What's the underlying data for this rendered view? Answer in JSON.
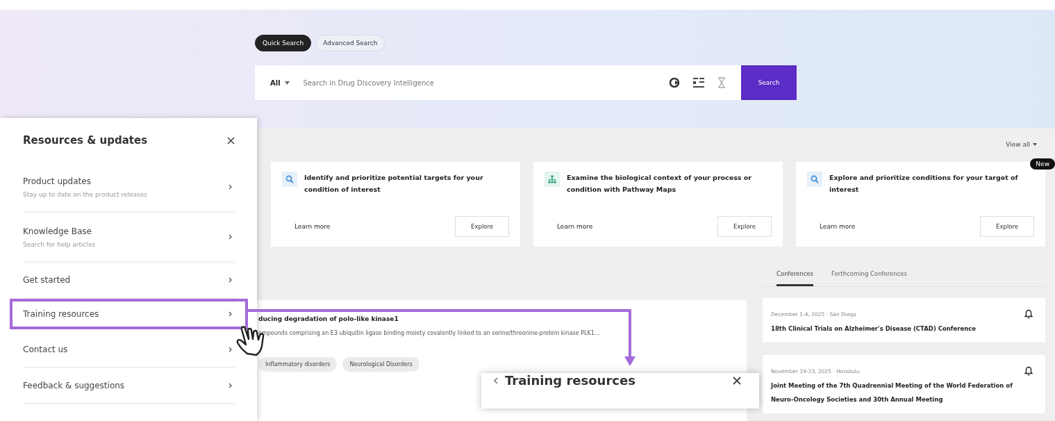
{
  "search_modes": [
    {
      "label": "Quick Search",
      "selected": true
    },
    {
      "label": "Advanced Search",
      "selected": false
    }
  ],
  "search": {
    "scope": "All",
    "placeholder": "Search in Drug Discovery Intelligence",
    "button": "Search"
  },
  "view_all": "View all",
  "feature_cards": [
    {
      "kind": "search",
      "text": "Identify and prioritize potential targets for your condition of interest",
      "link": "Learn more",
      "button": "Explore"
    },
    {
      "kind": "pathway",
      "text": "Examine the biological context of your process or condition with Pathway Maps",
      "link": "Learn more",
      "button": "Explore"
    },
    {
      "kind": "search",
      "text": "Explore and prioritize conditions for your target of interest",
      "link": "Learn more",
      "button": "Explore",
      "badge": "New"
    }
  ],
  "article": {
    "title": "ducing degradation of polo-like kinase1",
    "description": "ompounds comprising an E3 ubiquitin ligase binding moiety covalently linked to an serine/threonine-protein kinase PLK1...",
    "tags": [
      "Inflammatory disorders",
      "Neurological Disorders"
    ]
  },
  "conference_tabs": [
    {
      "label": "Conferences",
      "selected": true
    },
    {
      "label": "Forthcoming Conferences",
      "selected": false
    }
  ],
  "conferences": [
    {
      "meta": "December 1-4, 2025 · San Diego",
      "title": "18th Clinical Trials on Alzheimer's Disease (CTAD) Conference"
    },
    {
      "meta": "November 19-23, 2025 · Honolulu",
      "title": "Joint Meeting of the 7th Quadrennial Meeting of the World Federation of Neuro-Oncology Societies and 30th Annual Meeting"
    }
  ],
  "resources_panel": {
    "title": "Resources & updates",
    "items": [
      {
        "title": "Product updates",
        "subtitle": "Stay up to date on the product releases",
        "highlighted": false
      },
      {
        "title": "Knowledge Base",
        "subtitle": "Search for help articles",
        "highlighted": false
      },
      {
        "title": "Get started",
        "highlighted": false
      },
      {
        "title": "Training resources",
        "highlighted": true
      },
      {
        "title": "Contact us",
        "highlighted": false
      },
      {
        "title": "Feedback & suggestions",
        "highlighted": false
      }
    ]
  },
  "training_popup": {
    "title": "Training resources"
  }
}
